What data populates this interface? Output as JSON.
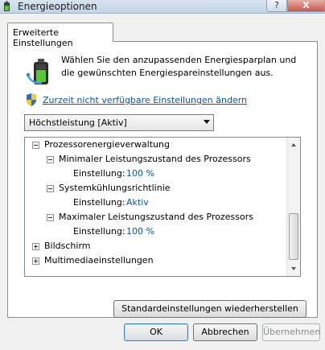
{
  "window": {
    "title": "Energieoptionen",
    "help_glyph": "?",
    "close_glyph": "X"
  },
  "tab": {
    "label": "Erweiterte Einstellungen"
  },
  "intro": {
    "text": "Wählen Sie den anzupassenden Energiesparplan und die gewünschten Energiespareinstellungen aus."
  },
  "admin_link": {
    "label": "Zurzeit nicht verfügbare Einstellungen ändern"
  },
  "plan_select": {
    "value": "Höchstleistung [Aktiv]"
  },
  "tree": {
    "processor_group": "Prozessorenergieverwaltung",
    "min_state": {
      "label": "Minimaler Leistungszustand des Prozessors",
      "setting_label": "Einstellung:",
      "setting_value": "100 %"
    },
    "cooling": {
      "label": "Systemkühlungsrichtlinie",
      "setting_label": "Einstellung:",
      "setting_value": "Aktiv"
    },
    "max_state": {
      "label": "Maximaler Leistungszustand des Prozessors",
      "setting_label": "Einstellung:",
      "setting_value": "100 %"
    },
    "display_group": "Bildschirm",
    "multimedia_group": "Multimediaeinstellungen"
  },
  "buttons": {
    "restore": "Standardeinstellungen wiederherstellen",
    "ok": "OK",
    "cancel": "Abbrechen",
    "apply": "Übernehmen"
  },
  "colors": {
    "link": "#0a55a8",
    "dialog_bg": "#f0f0f0"
  }
}
